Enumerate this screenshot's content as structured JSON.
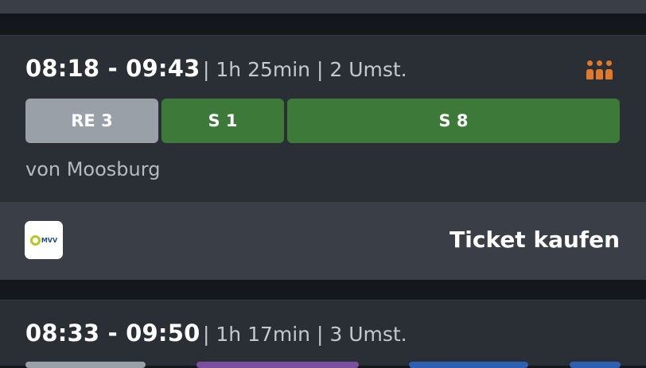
{
  "journey1": {
    "time_range": "08:18 - 09:43",
    "meta": "| 1h 25min | 2 Umst.",
    "segments": [
      {
        "label": "RE 3",
        "color": "#9aa0a8"
      },
      {
        "label": "S 1",
        "color": "#3d7a3a"
      },
      {
        "label": "S 8",
        "color": "#3d7a3a"
      }
    ],
    "origin": "von Moosburg",
    "occupancy_icon": "people-occupancy-icon",
    "occupancy_color": "#e07a2a"
  },
  "ticket": {
    "provider_logo_text": "MVV",
    "label": "Ticket kaufen"
  },
  "journey2": {
    "time_range": "08:33 - 09:50",
    "meta": "| 1h 17min | 3 Umst.",
    "segment_colors": [
      "#9aa0a8",
      "#7b4f9e",
      "#2f5fb0",
      "#2f5fb0"
    ]
  }
}
